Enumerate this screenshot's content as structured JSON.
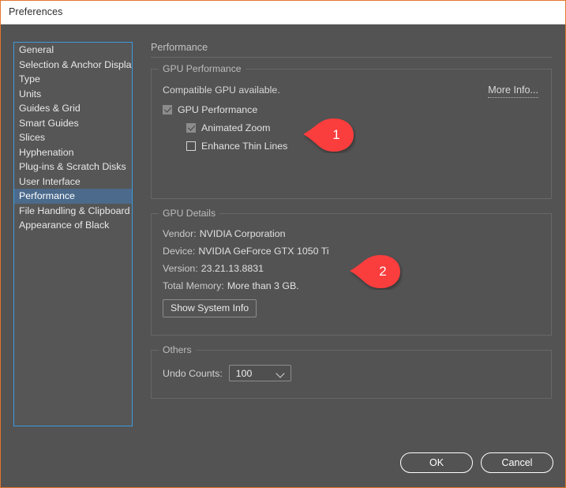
{
  "window": {
    "title": "Preferences",
    "accent_border": "#e3762b",
    "body_bg": "#535353",
    "titlebar_bg": "#ffffff"
  },
  "sidebar": {
    "focus_border_color": "#3d9ade",
    "selected_bg": "#4b6a8c",
    "items": [
      {
        "label": "General",
        "selected": false
      },
      {
        "label": "Selection & Anchor Display",
        "selected": false
      },
      {
        "label": "Type",
        "selected": false
      },
      {
        "label": "Units",
        "selected": false
      },
      {
        "label": "Guides & Grid",
        "selected": false
      },
      {
        "label": "Smart Guides",
        "selected": false
      },
      {
        "label": "Slices",
        "selected": false
      },
      {
        "label": "Hyphenation",
        "selected": false
      },
      {
        "label": "Plug-ins & Scratch Disks",
        "selected": false
      },
      {
        "label": "User Interface",
        "selected": false
      },
      {
        "label": "Performance",
        "selected": true
      },
      {
        "label": "File Handling & Clipboard",
        "selected": false
      },
      {
        "label": "Appearance of Black",
        "selected": false
      }
    ]
  },
  "panel": {
    "title": "Performance",
    "gpu_performance": {
      "legend": "GPU Performance",
      "status": "Compatible GPU available.",
      "more_info": "More Info...",
      "checkboxes": [
        {
          "label": "GPU Performance",
          "checked": true,
          "indent": false
        },
        {
          "label": "Animated Zoom",
          "checked": true,
          "indent": true
        },
        {
          "label": "Enhance Thin Lines",
          "checked": false,
          "indent": true
        }
      ]
    },
    "gpu_details": {
      "legend": "GPU Details",
      "rows": [
        {
          "key": "Vendor:",
          "value": "NVIDIA Corporation"
        },
        {
          "key": "Device:",
          "value": "NVIDIA GeForce GTX 1050 Ti"
        },
        {
          "key": "Version:",
          "value": "23.21.13.8831"
        },
        {
          "key": "Total Memory:",
          "value": "More than 3 GB."
        }
      ],
      "show_system_info": "Show System Info"
    },
    "others": {
      "legend": "Others",
      "undo_label": "Undo Counts:",
      "undo_value": "100",
      "undo_options": [
        "100"
      ]
    }
  },
  "footer": {
    "ok": "OK",
    "cancel": "Cancel"
  },
  "markers": {
    "color": "#fa3c3c",
    "one": "1",
    "two": "2"
  }
}
